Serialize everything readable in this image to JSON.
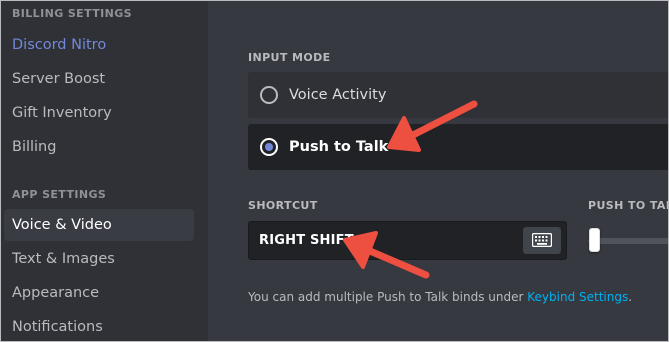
{
  "sidebar": {
    "billing_header": "BILLING SETTINGS",
    "app_header": "APP SETTINGS",
    "billing_items": [
      {
        "label": "Discord Nitro"
      },
      {
        "label": "Server Boost"
      },
      {
        "label": "Gift Inventory"
      },
      {
        "label": "Billing"
      }
    ],
    "app_items": [
      {
        "label": "Voice & Video",
        "active": true
      },
      {
        "label": "Text & Images"
      },
      {
        "label": "Appearance"
      },
      {
        "label": "Notifications"
      }
    ]
  },
  "main": {
    "input_mode": {
      "label": "INPUT MODE",
      "options": [
        {
          "label": "Voice Activity",
          "selected": false
        },
        {
          "label": "Push to Talk",
          "selected": true
        }
      ]
    },
    "shortcut": {
      "label": "SHORTCUT",
      "value": "RIGHT SHIFT",
      "record_icon": "keyboard-icon"
    },
    "release_delay": {
      "label": "PUSH TO TALK RELEASE DELAY",
      "level": 0
    },
    "help": {
      "text": "You can add multiple Push to Talk binds under ",
      "link": "Keybind Settings",
      "suffix": "."
    }
  },
  "annotations": {
    "arrow_color": "#ed4f40",
    "arrow_icon": "arrow-icon"
  }
}
